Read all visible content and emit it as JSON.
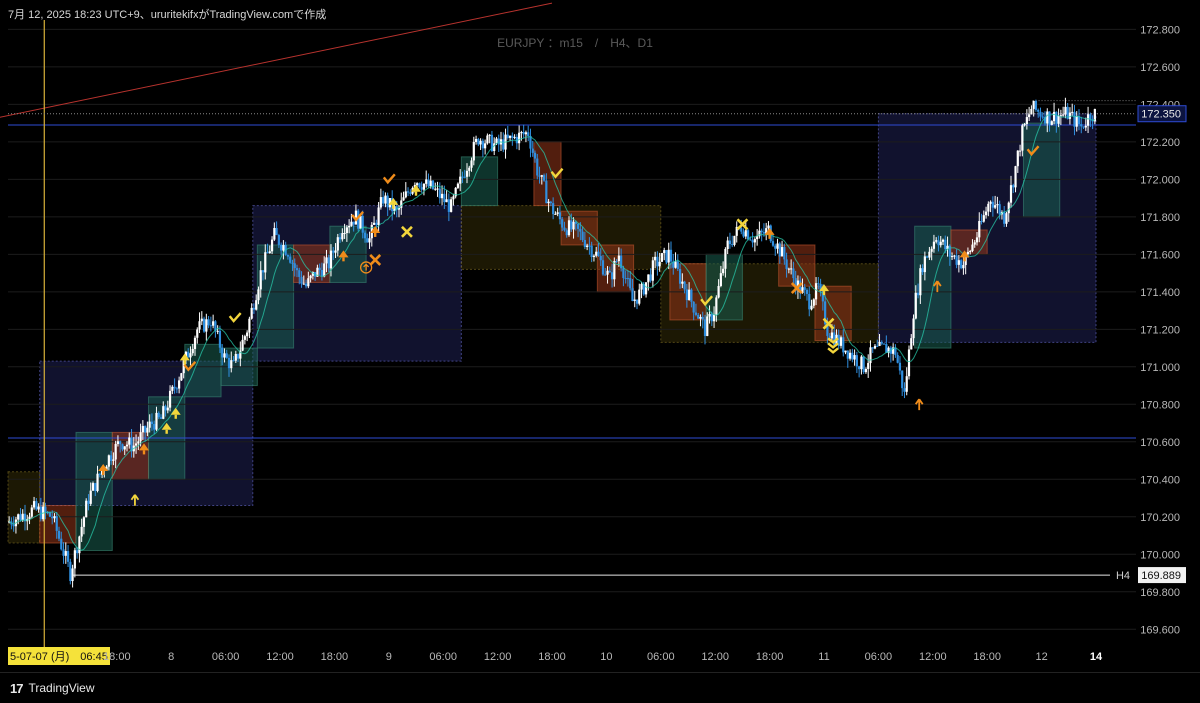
{
  "header": {
    "text": "7月 12, 2025 18:23 UTC+9、ururitekifxがTradingView.comで作成"
  },
  "watermark": "EURJPY ：m15　/　H4、D1",
  "footer": {
    "brand": "TradingView"
  },
  "colors": {
    "background": "#000000",
    "bull_candle": "#ffffff",
    "bear_candle": "#2f8fe0",
    "blue_line": "#2e4bd4",
    "red_line": "#b8332e",
    "vertical_line": "#d9b23a",
    "up_arrow": "#f08c1a",
    "yellow_marker": "#f2d53c"
  },
  "chart_data": {
    "type": "candlestick",
    "symbol": "EURJPY",
    "timeframe": "m15",
    "ylim": [
      169.5,
      172.85
    ],
    "y_ticks": [
      "169.600",
      "169.800",
      "170.000",
      "170.200",
      "170.400",
      "170.600",
      "170.800",
      "171.000",
      "171.200",
      "171.400",
      "171.600",
      "171.800",
      "172.000",
      "172.200",
      "172.400",
      "172.600",
      "172.800"
    ],
    "x_ticks": [
      {
        "label": "5-07-07 (月)　06:45",
        "highlight": true,
        "t": 0.0
      },
      {
        "label": "18:00",
        "t": 12.0
      },
      {
        "label": "8",
        "t": 18.0
      },
      {
        "label": "06:00",
        "t": 24.0
      },
      {
        "label": "12:00",
        "t": 30.0
      },
      {
        "label": "18:00",
        "t": 36.0
      },
      {
        "label": "9",
        "t": 42.0
      },
      {
        "label": "06:00",
        "t": 48.0
      },
      {
        "label": "12:00",
        "t": 54.0
      },
      {
        "label": "18:00",
        "t": 60.0
      },
      {
        "label": "10",
        "t": 66.0
      },
      {
        "label": "06:00",
        "t": 72.0
      },
      {
        "label": "12:00",
        "t": 78.0
      },
      {
        "label": "18:00",
        "t": 84.0
      },
      {
        "label": "11",
        "t": 90.0
      },
      {
        "label": "06:00",
        "t": 96.0
      },
      {
        "label": "12:00",
        "t": 102.0
      },
      {
        "label": "18:00",
        "t": 108.0
      },
      {
        "label": "12",
        "t": 114.0
      },
      {
        "label": "14",
        "t": 120.0,
        "bold": true
      }
    ],
    "price_labels": [
      {
        "value": 172.35,
        "text": "172.350",
        "style": "current"
      },
      {
        "value": 169.889,
        "text": "169.889",
        "tag": "H4",
        "style": "level"
      }
    ],
    "levels": [
      {
        "value": 170.62,
        "color": "#2e4bd4"
      },
      {
        "value": 172.29,
        "color": "#2e4bd4"
      }
    ],
    "boxes": [
      {
        "t0": 3.5,
        "t1": 27.0,
        "y0": 170.26,
        "y1": 171.03,
        "kind": "navy"
      },
      {
        "t0": 27.0,
        "t1": 50.0,
        "y0": 171.03,
        "y1": 171.86,
        "kind": "navy"
      },
      {
        "t0": 50.0,
        "t1": 72.0,
        "y0": 171.52,
        "y1": 171.86,
        "kind": "olive"
      },
      {
        "t0": 72.0,
        "t1": 96.0,
        "y0": 171.13,
        "y1": 171.55,
        "kind": "olive"
      },
      {
        "t0": 96.0,
        "t1": 120.0,
        "y0": 171.13,
        "y1": 172.35,
        "kind": "navy"
      },
      {
        "t0": 0.0,
        "t1": 3.5,
        "y0": 170.06,
        "y1": 170.44,
        "kind": "olive"
      },
      {
        "t0": 3.5,
        "t1": 7.5,
        "y0": 170.06,
        "y1": 170.26,
        "kind": "red"
      },
      {
        "t0": 7.5,
        "t1": 11.5,
        "y0": 170.02,
        "y1": 170.65,
        "kind": "teal"
      },
      {
        "t0": 11.5,
        "t1": 15.5,
        "y0": 170.4,
        "y1": 170.65,
        "kind": "red"
      },
      {
        "t0": 15.5,
        "t1": 19.5,
        "y0": 170.4,
        "y1": 170.84,
        "kind": "teal"
      },
      {
        "t0": 19.5,
        "t1": 23.5,
        "y0": 170.84,
        "y1": 171.12,
        "kind": "teal"
      },
      {
        "t0": 23.5,
        "t1": 27.5,
        "y0": 170.9,
        "y1": 171.1,
        "kind": "teal"
      },
      {
        "t0": 27.5,
        "t1": 31.5,
        "y0": 171.1,
        "y1": 171.65,
        "kind": "teal"
      },
      {
        "t0": 31.5,
        "t1": 35.5,
        "y0": 171.45,
        "y1": 171.65,
        "kind": "red"
      },
      {
        "t0": 35.5,
        "t1": 39.5,
        "y0": 171.45,
        "y1": 171.75,
        "kind": "teal"
      },
      {
        "t0": 50.0,
        "t1": 54.0,
        "y0": 171.86,
        "y1": 172.12,
        "kind": "teal"
      },
      {
        "t0": 58.0,
        "t1": 61.0,
        "y0": 171.86,
        "y1": 172.2,
        "kind": "red"
      },
      {
        "t0": 61.0,
        "t1": 65.0,
        "y0": 171.65,
        "y1": 171.83,
        "kind": "red"
      },
      {
        "t0": 65.0,
        "t1": 69.0,
        "y0": 171.4,
        "y1": 171.65,
        "kind": "red"
      },
      {
        "t0": 73.0,
        "t1": 77.0,
        "y0": 171.25,
        "y1": 171.55,
        "kind": "red"
      },
      {
        "t0": 77.0,
        "t1": 81.0,
        "y0": 171.25,
        "y1": 171.6,
        "kind": "teal"
      },
      {
        "t0": 85.0,
        "t1": 89.0,
        "y0": 171.43,
        "y1": 171.65,
        "kind": "red"
      },
      {
        "t0": 89.0,
        "t1": 93.0,
        "y0": 171.14,
        "y1": 171.43,
        "kind": "red"
      },
      {
        "t0": 100.0,
        "t1": 104.0,
        "y0": 171.1,
        "y1": 171.75,
        "kind": "teal"
      },
      {
        "t0": 104.0,
        "t1": 108.0,
        "y0": 171.6,
        "y1": 171.73,
        "kind": "red"
      },
      {
        "t0": 112.0,
        "t1": 116.0,
        "y0": 171.8,
        "y1": 172.3,
        "kind": "teal"
      }
    ],
    "trendline": [
      {
        "t": -1.0,
        "y": 172.33
      },
      {
        "t": 60.0,
        "y": 172.94
      }
    ],
    "vertical_line_t": 4.0,
    "waypoints": [
      [
        0,
        170.17
      ],
      [
        3,
        170.24
      ],
      [
        5,
        170.2
      ],
      [
        7,
        169.9
      ],
      [
        9,
        170.3
      ],
      [
        11,
        170.5
      ],
      [
        12.5,
        170.6
      ],
      [
        14,
        170.58
      ],
      [
        16,
        170.7
      ],
      [
        17,
        170.72
      ],
      [
        19,
        170.95
      ],
      [
        21,
        171.2
      ],
      [
        22.5,
        171.25
      ],
      [
        24,
        171.05
      ],
      [
        25,
        171.0
      ],
      [
        26.5,
        171.2
      ],
      [
        28,
        171.5
      ],
      [
        29.5,
        171.7
      ],
      [
        31,
        171.62
      ],
      [
        32,
        171.5
      ],
      [
        33,
        171.43
      ],
      [
        34,
        171.5
      ],
      [
        35.5,
        171.55
      ],
      [
        37,
        171.75
      ],
      [
        38.5,
        171.8
      ],
      [
        40,
        171.68
      ],
      [
        41.5,
        171.9
      ],
      [
        43,
        171.82
      ],
      [
        45,
        172.0
      ],
      [
        47,
        171.95
      ],
      [
        49,
        171.85
      ],
      [
        50.5,
        172.05
      ],
      [
        52,
        172.22
      ],
      [
        54,
        172.18
      ],
      [
        56,
        172.22
      ],
      [
        57.5,
        172.25
      ],
      [
        58.5,
        172.05
      ],
      [
        60,
        171.85
      ],
      [
        61.5,
        171.75
      ],
      [
        63,
        171.72
      ],
      [
        65,
        171.6
      ],
      [
        66.5,
        171.47
      ],
      [
        67.5,
        171.6
      ],
      [
        69,
        171.35
      ],
      [
        70,
        171.4
      ],
      [
        71.5,
        171.55
      ],
      [
        73,
        171.6
      ],
      [
        74.5,
        171.45
      ],
      [
        75.5,
        171.35
      ],
      [
        77,
        171.2
      ],
      [
        78,
        171.3
      ],
      [
        79.5,
        171.65
      ],
      [
        81,
        171.75
      ],
      [
        82.5,
        171.68
      ],
      [
        84,
        171.73
      ],
      [
        85.5,
        171.6
      ],
      [
        87,
        171.45
      ],
      [
        88.5,
        171.35
      ],
      [
        89.5,
        171.42
      ],
      [
        90.5,
        171.2
      ],
      [
        92,
        171.12
      ],
      [
        93.5,
        171.05
      ],
      [
        94.5,
        171.0
      ],
      [
        95.5,
        171.08
      ],
      [
        97,
        171.1
      ],
      [
        98,
        171.08
      ],
      [
        99,
        170.85
      ],
      [
        100,
        171.3
      ],
      [
        101,
        171.55
      ],
      [
        102.5,
        171.7
      ],
      [
        104,
        171.6
      ],
      [
        105.5,
        171.55
      ],
      [
        107,
        171.7
      ],
      [
        108.5,
        171.9
      ],
      [
        110,
        171.8
      ],
      [
        111,
        172.0
      ],
      [
        112,
        172.25
      ],
      [
        113,
        172.38
      ],
      [
        115,
        172.33
      ],
      [
        117,
        172.35
      ],
      [
        118.5,
        172.28
      ],
      [
        119.5,
        172.35
      ]
    ],
    "markers": [
      {
        "kind": "up-arrow",
        "t": 14.0,
        "y": 170.28,
        "color": "#f2d53c"
      },
      {
        "kind": "up-arrow",
        "t": 102.5,
        "y": 171.42,
        "color": "#f08c1a"
      },
      {
        "kind": "up-arrow",
        "t": 100.5,
        "y": 170.79,
        "color": "#f08c1a"
      },
      {
        "kind": "triangle-up",
        "t": 10.5,
        "y": 170.46,
        "color": "#f08c1a"
      },
      {
        "kind": "triangle-up",
        "t": 15.0,
        "y": 170.57,
        "color": "#f08c1a"
      },
      {
        "kind": "triangle-up",
        "t": 17.5,
        "y": 170.68,
        "color": "#f2d53c"
      },
      {
        "kind": "triangle-up",
        "t": 18.5,
        "y": 170.76,
        "color": "#f2d53c"
      },
      {
        "kind": "triangle-up",
        "t": 19.5,
        "y": 171.05,
        "color": "#f2d53c"
      },
      {
        "kind": "triangle-up",
        "t": 37.0,
        "y": 171.6,
        "color": "#f08c1a"
      },
      {
        "kind": "triangle-up",
        "t": 40.5,
        "y": 171.73,
        "color": "#f08c1a"
      },
      {
        "kind": "triangle-up",
        "t": 42.5,
        "y": 171.88,
        "color": "#f2d53c"
      },
      {
        "kind": "triangle-up",
        "t": 45.0,
        "y": 171.95,
        "color": "#f2d53c"
      },
      {
        "kind": "triangle-up",
        "t": 84.0,
        "y": 171.72,
        "color": "#f08c1a"
      },
      {
        "kind": "triangle-up",
        "t": 90.0,
        "y": 171.42,
        "color": "#f2d53c"
      },
      {
        "kind": "triangle-up",
        "t": 105.5,
        "y": 171.6,
        "color": "#f08c1a"
      },
      {
        "kind": "check",
        "t": 20.0,
        "y": 171.0,
        "color": "#f08c1a"
      },
      {
        "kind": "check",
        "t": 25.0,
        "y": 171.26,
        "color": "#f2d53c"
      },
      {
        "kind": "check",
        "t": 38.5,
        "y": 171.8,
        "color": "#f08c1a"
      },
      {
        "kind": "check",
        "t": 42.0,
        "y": 172.0,
        "color": "#f08c1a"
      },
      {
        "kind": "check",
        "t": 60.5,
        "y": 172.03,
        "color": "#f2d53c"
      },
      {
        "kind": "check",
        "t": 77.0,
        "y": 171.35,
        "color": "#f2d53c"
      },
      {
        "kind": "check",
        "t": 113.0,
        "y": 172.15,
        "color": "#f08c1a"
      },
      {
        "kind": "cross",
        "t": 44.0,
        "y": 171.72,
        "color": "#f2d53c"
      },
      {
        "kind": "cross",
        "t": 40.5,
        "y": 171.57,
        "color": "#f08c1a"
      },
      {
        "kind": "cross",
        "t": 81.0,
        "y": 171.76,
        "color": "#f2d53c"
      },
      {
        "kind": "cross",
        "t": 87.0,
        "y": 171.42,
        "color": "#f08c1a"
      },
      {
        "kind": "cross",
        "t": 90.5,
        "y": 171.23,
        "color": "#f2d53c"
      },
      {
        "kind": "chevron-stack",
        "t": 91.0,
        "y": 171.12,
        "color": "#f2d53c"
      },
      {
        "kind": "circle-arrow",
        "t": 39.5,
        "y": 171.53,
        "color": "#f08c1a"
      }
    ]
  }
}
